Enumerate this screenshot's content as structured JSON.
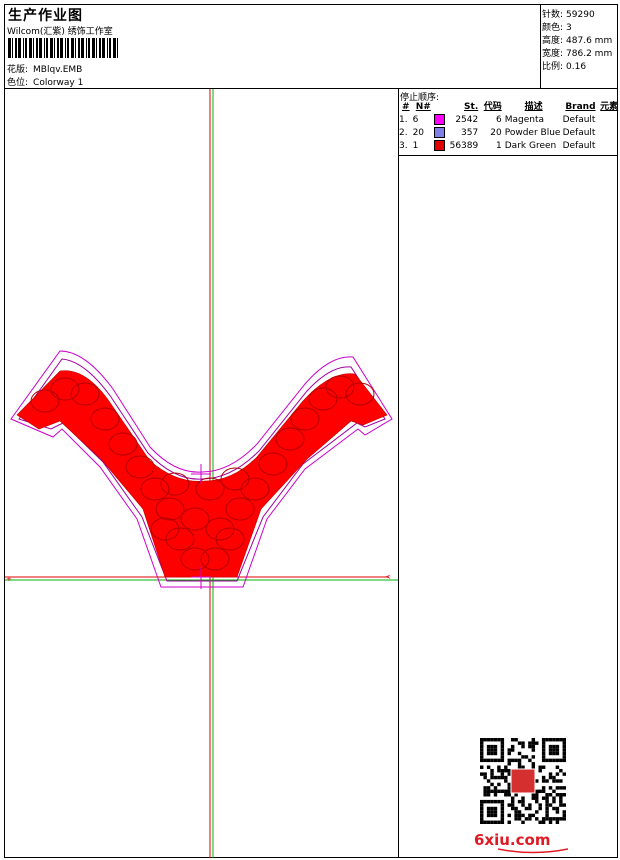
{
  "header": {
    "title": "生产作业图",
    "subtitle": "Wilcom(汇紫) 绣饰工作室",
    "pattern_label": "花版:",
    "pattern_value": "MBlqv.EMB",
    "colorway_label": "色位:",
    "colorway_value": "Colorway 1"
  },
  "stats": {
    "stitches_label": "针数:",
    "stitches_value": "59290",
    "colors_label": "颜色:",
    "colors_value": "3",
    "height_label": "高度:",
    "height_value": "487.6 mm",
    "width_label": "宽度:",
    "width_value": "786.2 mm",
    "scale_label": "比例:",
    "scale_value": "0.16"
  },
  "stop_sequence": {
    "title": "停止顺序:",
    "headers": [
      "#",
      "N#",
      "",
      "St.",
      "代码",
      "描述",
      "Brand",
      "元素"
    ],
    "rows": [
      {
        "idx": "1.",
        "n": "6",
        "color": "#ff00ff",
        "st": "2542",
        "code": "6",
        "desc": "Magenta",
        "brand": "Default"
      },
      {
        "idx": "2.",
        "n": "20",
        "color": "#8080e8",
        "st": "357",
        "code": "20",
        "desc": "Powder Blue",
        "brand": "Default"
      },
      {
        "idx": "3.",
        "n": "1",
        "color": "#e00000",
        "st": "56389",
        "code": "1",
        "desc": "Dark Green",
        "brand": "Default"
      }
    ]
  },
  "design": {
    "primary_color": "#ff0000",
    "outline_color": "#cc00cc",
    "outline2_color": "#a000a0",
    "axis_green": "#00b000",
    "axis_red": "#e00000"
  },
  "watermark": {
    "text": "6xiu.com",
    "color": "#e01a24"
  }
}
